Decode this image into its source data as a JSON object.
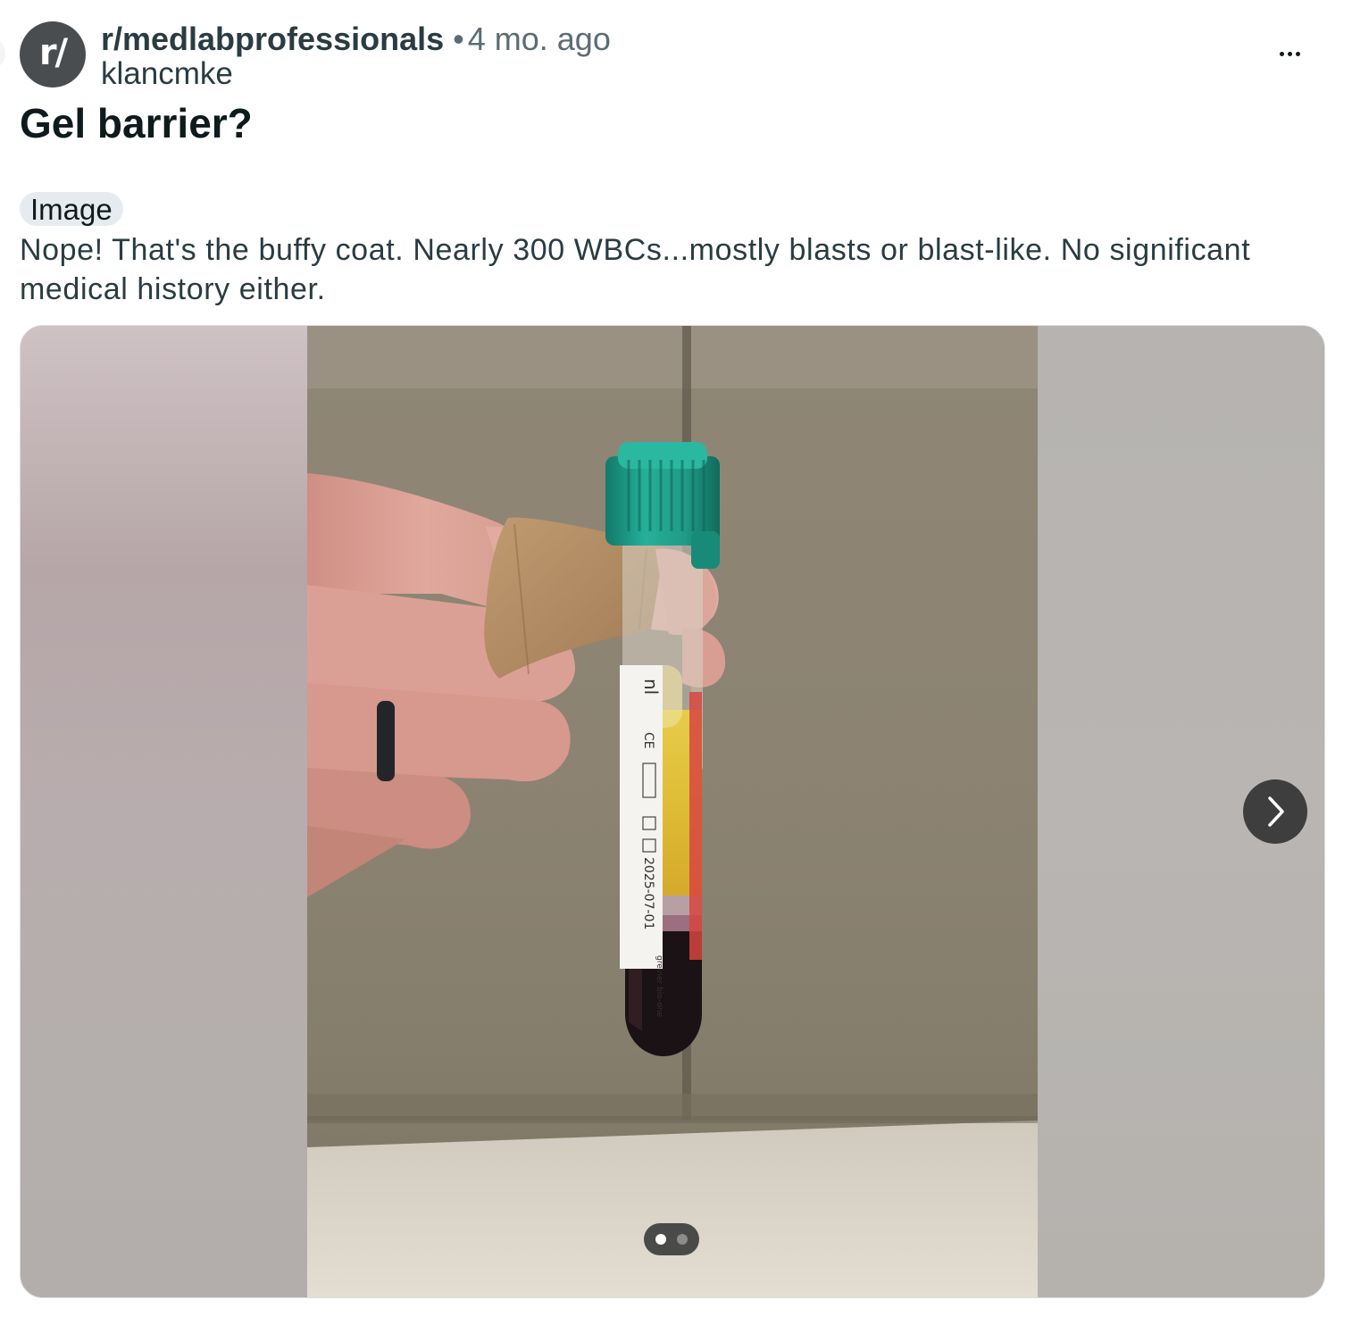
{
  "post": {
    "subreddit": "r/medlabprofessionals",
    "separator": "•",
    "time_ago": "4 mo. ago",
    "author": "klancmke",
    "avatar_text": "r/",
    "title": "Gel barrier?",
    "flair": "Image",
    "body": "Nope! That's the buffy coat. Nearly 300 WBCs...mostly blasts or blast-like. No significant medical history either."
  },
  "gallery": {
    "current_index": 1,
    "total": 2,
    "image_subject": "blood collection tube held between fingers",
    "tube_label": {
      "volume_fragment": "nl",
      "ce_mark": "CE",
      "expiry_date": "2025-07-01",
      "manufacturer": "greiner bio-one"
    }
  },
  "icons": {
    "more": "more-options-icon",
    "next": "chevron-right-icon"
  },
  "colors": {
    "avatar_bg": "#4a4d50",
    "flair_bg": "#e5ebee",
    "tube_cap": "#1f9b86",
    "plasma": "#e0c13a",
    "nav_button": "#3d3e3d"
  }
}
